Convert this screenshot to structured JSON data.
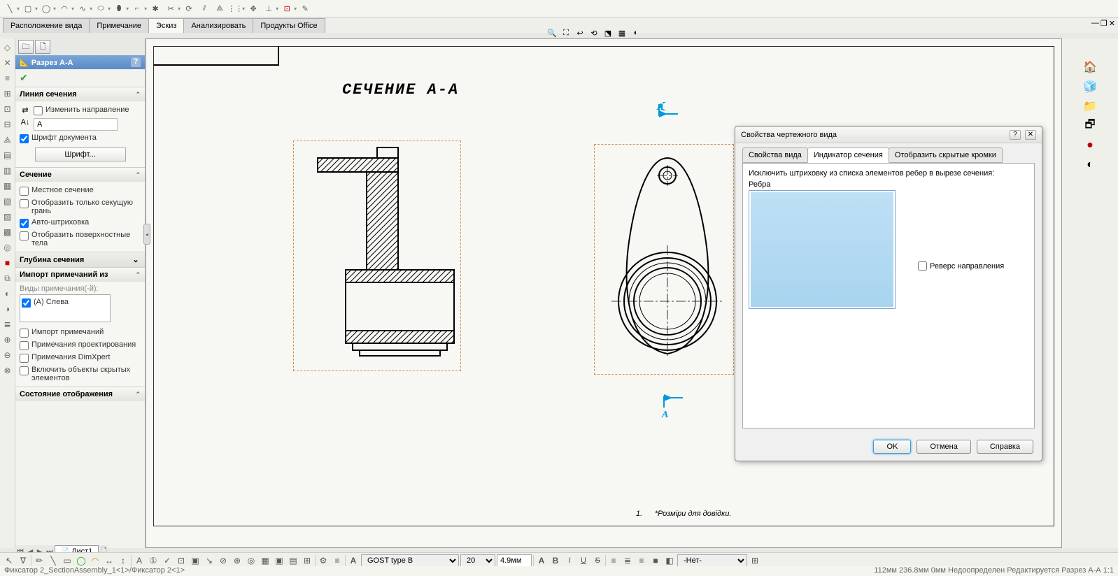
{
  "tabs": {
    "view_layout": "Расположение вида",
    "annotation": "Примечание",
    "sketch": "Эскиз",
    "evaluate": "Анализировать",
    "office": "Продукты Office"
  },
  "prop": {
    "title": "Разрез А-А",
    "section_line_hdr": "Линия сечения",
    "change_direction": "Изменить направление",
    "label_value": "A",
    "doc_font": "Шрифт документа",
    "font_btn": "Шрифт...",
    "section_hdr": "Сечение",
    "partial": "Местное сечение",
    "only_cut": "Отобразить только секущую грань",
    "auto_hatch": "Авто-штриховка",
    "surface_bodies": "Отобразить поверхностные тела",
    "depth_hdr": "Глубина сечения",
    "import_hdr": "Импорт примечаний из",
    "annot_views": "Виды примечания(-й):",
    "left_view": "(A) Слева",
    "import_annot": "Импорт примечаний",
    "design_annot": "Примечания проектирования",
    "dimxpert": "Примечания DimXpert",
    "hidden_feat": "Включить объекты скрытых элементов",
    "display_state_hdr": "Состояние отображения"
  },
  "canvas": {
    "section_title": "СЕЧЕНИЕ А-А",
    "arrow_label": "А",
    "footnote_num": "1.",
    "footnote_text": "*Розміри для довідки."
  },
  "sheet": {
    "name": "Лист1"
  },
  "dialog": {
    "title": "Свойства чертежного вида",
    "tab1": "Свойства вида",
    "tab2": "Индикатор сечения",
    "tab3": "Отобразить скрытые кромки",
    "instr": "Исключить штриховку из списка элементов ребер в вырезе сечения:",
    "edges": "Ребра",
    "reverse": "Реверс направления",
    "ok": "OK",
    "cancel": "Отмена",
    "help": "Справка"
  },
  "bottom": {
    "font_name": "GOST type B",
    "font_size": "20",
    "dim_value": "4.9мм",
    "layer": "-Нет-"
  },
  "status": {
    "left": "Фиксатор 2_SectionAssembly_1<1>/Фиксатор 2<1>",
    "right": "112мм    236.8мм   0мм  Недоопределен    Редактируется Разрез А-А   1:1"
  }
}
